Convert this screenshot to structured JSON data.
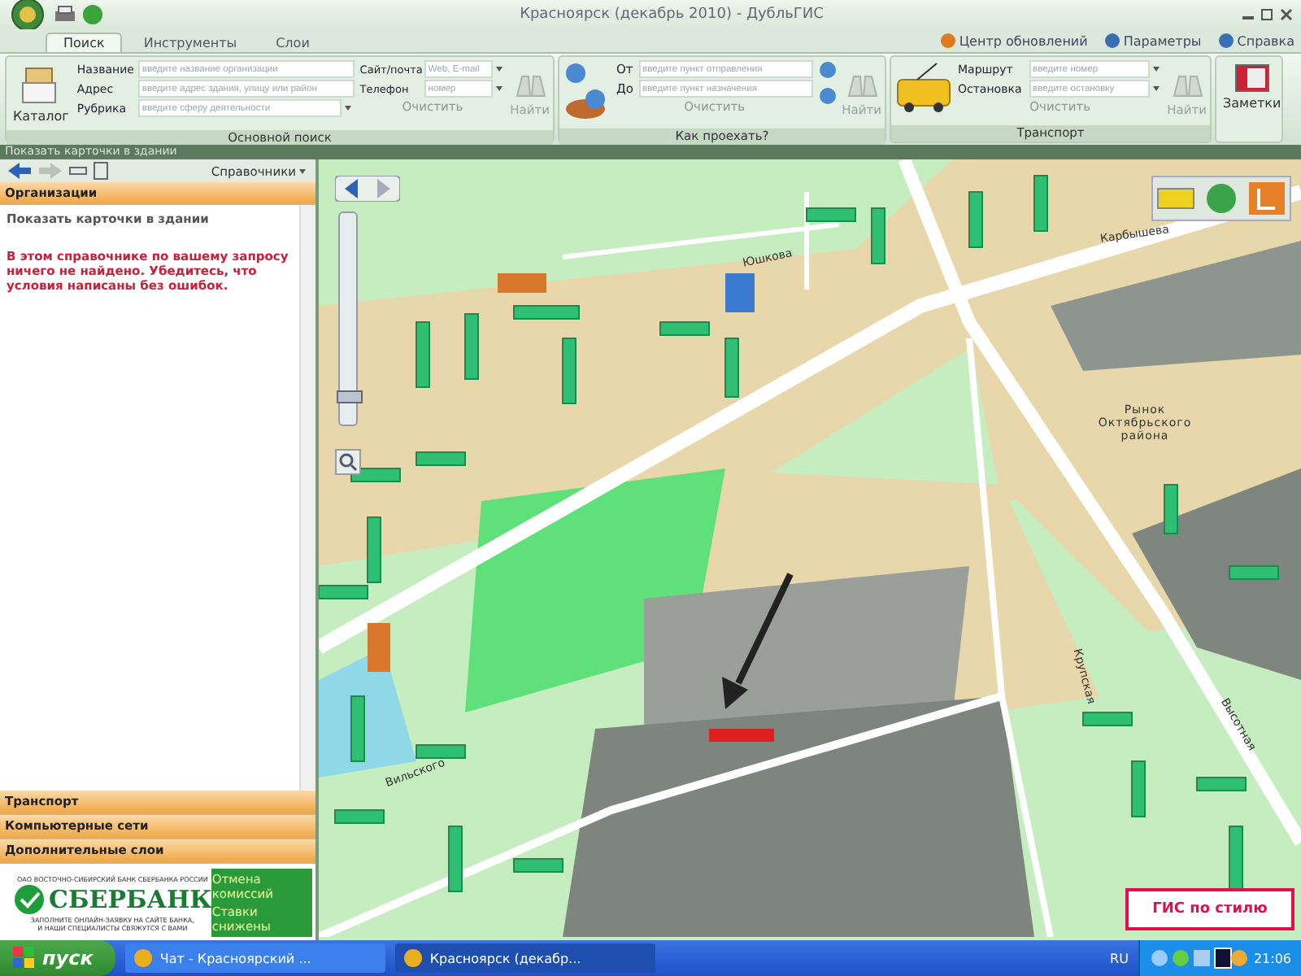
{
  "window": {
    "title": "Красноярск (декабрь 2010) - ДубльГИС"
  },
  "tabs": [
    {
      "label": "Поиск",
      "selected": true
    },
    {
      "label": "Инструменты",
      "selected": false
    },
    {
      "label": "Слои",
      "selected": false
    }
  ],
  "header_links": [
    "Центр обновлений",
    "Параметры",
    "Справка"
  ],
  "ribbon": {
    "groups": [
      {
        "kind": "search",
        "title": "Основной поиск",
        "big_button": "Каталог",
        "fields": [
          {
            "label": "Название",
            "placeholder": "введите название организации",
            "dropdown": false
          },
          {
            "label": "Адрес",
            "placeholder": "введите адрес здания, улицу или район",
            "dropdown": false
          },
          {
            "label": "Рубрика",
            "placeholder": "введите сферу деятельности",
            "dropdown": true
          }
        ],
        "side_fields": [
          {
            "label": "Сайт/почта",
            "placeholder": "Web, E-mail",
            "dropdown": true
          },
          {
            "label": "Телефон",
            "placeholder": "номер",
            "dropdown": true
          }
        ],
        "clear": "Очистить",
        "find": "Найти"
      },
      {
        "kind": "route",
        "title": "Как проехать?",
        "fields": [
          {
            "label": "От",
            "placeholder": "введите пункт отправления",
            "dropdown": false
          },
          {
            "label": "До",
            "placeholder": "введите пункт назначения",
            "dropdown": false
          }
        ],
        "clear": "Очистить",
        "find": "Найти"
      },
      {
        "kind": "transport",
        "title": "Транспорт",
        "fields": [
          {
            "label": "Маршрут",
            "placeholder": "введите номер",
            "dropdown": true
          },
          {
            "label": "Остановка",
            "placeholder": "введите остановку",
            "dropdown": true
          }
        ],
        "clear": "Очистить",
        "find": "Найти"
      },
      {
        "kind": "notes",
        "big_button": "Заметки"
      }
    ]
  },
  "hint_bar": "Показать карточки в здании",
  "sidebar": {
    "dropdown": "Справочники",
    "header": "Организации",
    "link": "Показать карточки в здании",
    "message": "В этом справочнике по вашему запросу ничего не найдено. Убедитесь, что условия написаны без ошибок.",
    "sections": [
      "Транспорт",
      "Компьютерные сети",
      "Дополнительные слои"
    ],
    "ad": {
      "caption": "ОАО ВОСТОЧНО-СИБИРСКИЙ БАНК СБЕРБАНКА РОССИИ",
      "brand": "СБЕРБАНК",
      "note": "ЗАПОЛНИТЕ ОНЛАЙН-ЗАЯВКУ НА САЙТЕ БАНКА, И НАШИ СПЕЦИАЛИСТЫ СВЯЖУТСЯ С ВАМИ",
      "offer": [
        "Отмена комиссий",
        "Ставки снижены"
      ]
    }
  },
  "map": {
    "zoom": {
      "level": 0.1
    },
    "labels": [
      {
        "text": "Юшкова",
        "kind": "street"
      },
      {
        "text": "Карбышева",
        "kind": "street"
      },
      {
        "text": "Рынок Октябрьского района",
        "kind": "place"
      },
      {
        "text": "Высотная",
        "kind": "street"
      },
      {
        "text": "Крупская",
        "kind": "street"
      },
      {
        "text": "Вильского",
        "kind": "street"
      }
    ],
    "ad": "ГИС по стилю"
  },
  "taskbar": {
    "start": "пуск",
    "tasks": [
      {
        "label": "Чат - Красноярский ...",
        "selected": false
      },
      {
        "label": "Красноярск (декабр...",
        "selected": true
      }
    ],
    "language": "RU",
    "clock": "21:06"
  }
}
